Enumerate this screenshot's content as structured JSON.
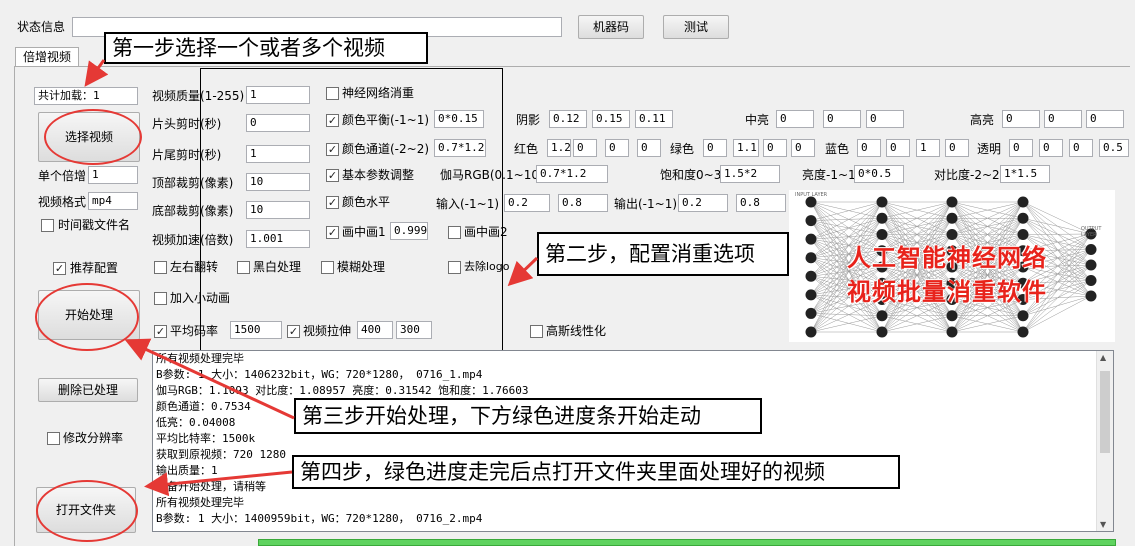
{
  "top": {
    "status_label": "状态信息",
    "status_value": "",
    "machine_code_button": "机器码",
    "test_button": "测试"
  },
  "tab": {
    "label": "倍增视频"
  },
  "left": {
    "total_label": "共计加载：1",
    "select_button": "选择视频",
    "single_label": "单个倍增",
    "single_value": "1",
    "format_label": "视频格式",
    "format_value": "mp4",
    "timestamp_label": "时间戳文件名",
    "timestamp_checked": false,
    "recommend_label": "推荐配置",
    "recommend_checked": true,
    "start_button": "开始处理",
    "delete_button": "删除已处理",
    "resolution_label": "修改分辨率",
    "resolution_checked": false,
    "open_folder_button": "打开文件夹"
  },
  "params": {
    "quality_label": "视频质量(1-255)",
    "quality_value": "1",
    "head_label": "片头剪时(秒)",
    "head_value": "0",
    "tail_label": "片尾剪时(秒)",
    "tail_value": "1",
    "top_crop_label": "顶部裁剪(像素)",
    "top_crop_value": "10",
    "bottom_crop_label": "底部裁剪(像素)",
    "bottom_crop_value": "10",
    "speed_label": "视频加速(倍数)",
    "speed_value": "1.001",
    "flip_label": "左右翻转",
    "flip_checked": false,
    "bw_label": "黑白处理",
    "bw_checked": false,
    "blur_label": "模糊处理",
    "blur_checked": false,
    "anim_label": "加入小动画",
    "anim_checked": false,
    "bitrate_label": "平均码率",
    "bitrate_checked": true,
    "bitrate_value": "1500",
    "stretch_label": "视频拉伸",
    "stretch_checked": true,
    "stretch_w": "400",
    "stretch_h": "300"
  },
  "effects": {
    "neural_label": "神经网络消重",
    "neural_checked": false,
    "balance_label": "颜色平衡(-1~1)",
    "balance_checked": true,
    "balance_value": "0*0.15",
    "channel_label": "颜色通道(-2~2)",
    "channel_checked": true,
    "channel_value": "0.7*1.2",
    "basic_label": "基本参数调整",
    "basic_checked": true,
    "level_label": "颜色水平",
    "level_checked": true,
    "pip1_label": "画中画1",
    "pip1_checked": true,
    "pip1_value": "0.999",
    "pip2_label": "画中画2",
    "pip2_checked": false,
    "logo_label": "去除logo",
    "logo_checked": false,
    "gauss_label": "高斯线性化",
    "gauss_checked": false,
    "shadow_label": "阴影",
    "shadow_values": [
      "0.12",
      "0.15",
      "0.11"
    ],
    "mid_label": "中亮",
    "mid_values": [
      "0",
      "0",
      "0"
    ],
    "high_label": "高亮",
    "high_values": [
      "0",
      "0",
      "0"
    ],
    "red_label": "红色",
    "red_values": [
      "1.2",
      "0",
      "0",
      "0"
    ],
    "green_label": "绿色",
    "green_values": [
      "0",
      "1.1",
      "0",
      "0"
    ],
    "blue_label": "蓝色",
    "blue_values": [
      "0",
      "0",
      "1",
      "0"
    ],
    "alpha_label": "透明",
    "alpha_values": [
      "0",
      "0",
      "0",
      "0.5"
    ],
    "gamma_label": "伽马RGB(0.1~10)",
    "gamma_value": "0.7*1.2",
    "sat_label": "饱和度0~3",
    "sat_value": "1.5*2",
    "bright_label": "亮度-1~1",
    "bright_value": "0*0.5",
    "contrast_label": "对比度-2~2",
    "contrast_value": "1*1.5",
    "input_label": "输入(-1~1)",
    "input_values": [
      "0.2",
      "0.8"
    ],
    "output_label": "输出(-1~1)",
    "output_values": [
      "0.2",
      "0.8"
    ]
  },
  "banner": {
    "line1": "人工智能神经网络",
    "line2": "视频批量消重软件",
    "nn_input_label": "INPUT LAYER",
    "nn_output_label": "OUTPUT LAYER"
  },
  "annotations": {
    "step1": "第一步选择一个或者多个视频",
    "step2": "第二步，配置消重选项",
    "step3": "第三步开始处理，下方绿色进度条开始走动",
    "step4": "第四步，绿色进度走完后点打开文件夹里面处理好的视频"
  },
  "log": {
    "lines": [
      "所有视频处理完毕",
      "B参数:  1  大小：1406232bit，WG：720*1280， 0716_1.mp4",
      "伽马RGB：1.1093 对比度：1.08957 亮度：0.31542 饱和度：1.76603",
      "颜色通道：0.7534",
      "低亮：0.04008",
      "平均比特率：1500k",
      "获取到原视频：720  1280",
      "输出质量：1",
      "准备开始处理，请稍等",
      "所有视频处理完毕",
      "B参数:  1  大小：1400959bit，WG：720*1280， 0716_2.mp4"
    ]
  },
  "colors": {
    "annotation_red": "#e53935",
    "banner_red": "#e8231b",
    "progress_green": "#5fd35f"
  }
}
